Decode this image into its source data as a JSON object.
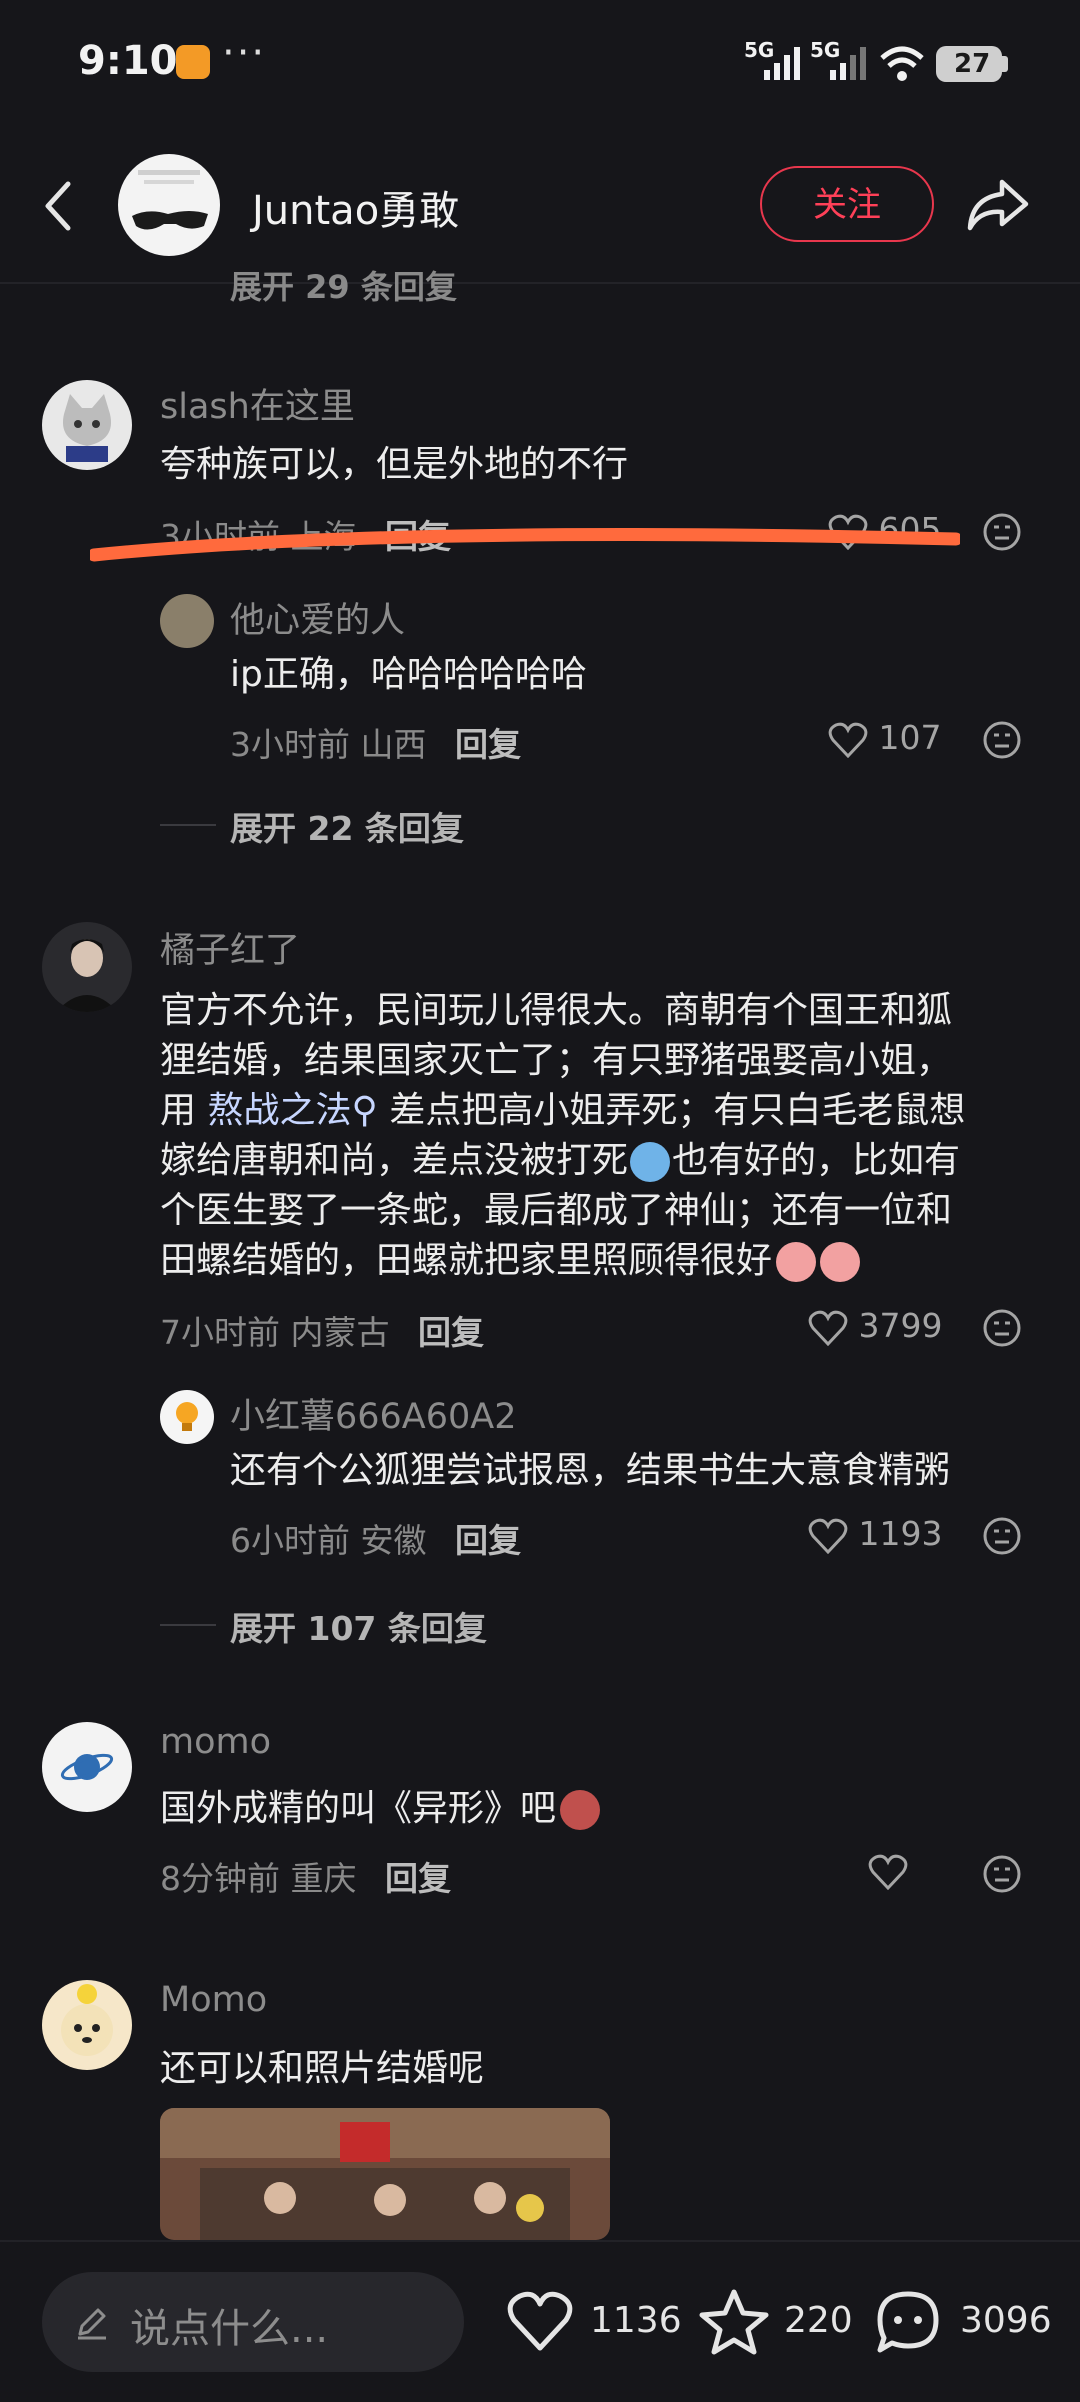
{
  "status_bar": {
    "time": "9:10",
    "net1": "5G",
    "net2": "5G",
    "battery": "27"
  },
  "header": {
    "author": "Juntao勇敢",
    "follow_label": "关注"
  },
  "cut_text": "展开 29 条回复",
  "comments": [
    {
      "user": "slash在这里",
      "text": "夸种族可以，但是外地的不行",
      "time": "3小时前",
      "location": "上海",
      "reply": "回复",
      "likes": "605",
      "replies": [
        {
          "user": "他心爱的人",
          "text": "ip正确，哈哈哈哈哈哈",
          "time": "3小时前",
          "location": "山西",
          "reply": "回复",
          "likes": "107"
        }
      ],
      "expand": "展开 22 条回复"
    },
    {
      "user": "橘子红了",
      "text_lines": [
        "官方不允许，民间玩儿得很大。商朝有个国王和狐",
        "狸结婚，结果国家灭亡了；有只野猪强娶高小姐，",
        "差点把高小姐弄死；有只白毛老鼠想",
        "嫁给唐朝和尚，差点没被打死",
        "也有好的，比如有",
        "个医生娶了一条蛇，最后都成了神仙；还有一位和",
        "田螺结婚的，田螺就把家里照顾得很好"
      ],
      "inline_prefix": "用",
      "inline_link": "熬战之法",
      "time": "7小时前",
      "location": "内蒙古",
      "reply": "回复",
      "likes": "3799",
      "replies": [
        {
          "user": "小红薯666A60A2",
          "text": "还有个公狐狸尝试报恩，结果书生大意食精粥",
          "time": "6小时前",
          "location": "安徽",
          "reply": "回复",
          "likes": "1193"
        }
      ],
      "expand": "展开 107 条回复"
    },
    {
      "user": "momo",
      "text": "国外成精的叫《异形》吧",
      "time": "8分钟前",
      "location": "重庆",
      "reply": "回复"
    },
    {
      "user": "Momo",
      "text": "还可以和照片结婚呢"
    }
  ],
  "bottom_bar": {
    "placeholder": "说点什么...",
    "likes": "1136",
    "stars": "220",
    "comments": "3096"
  },
  "colors": {
    "background": "#16161a",
    "accent": "#ff4058",
    "highlight": "#ff6a3d"
  }
}
